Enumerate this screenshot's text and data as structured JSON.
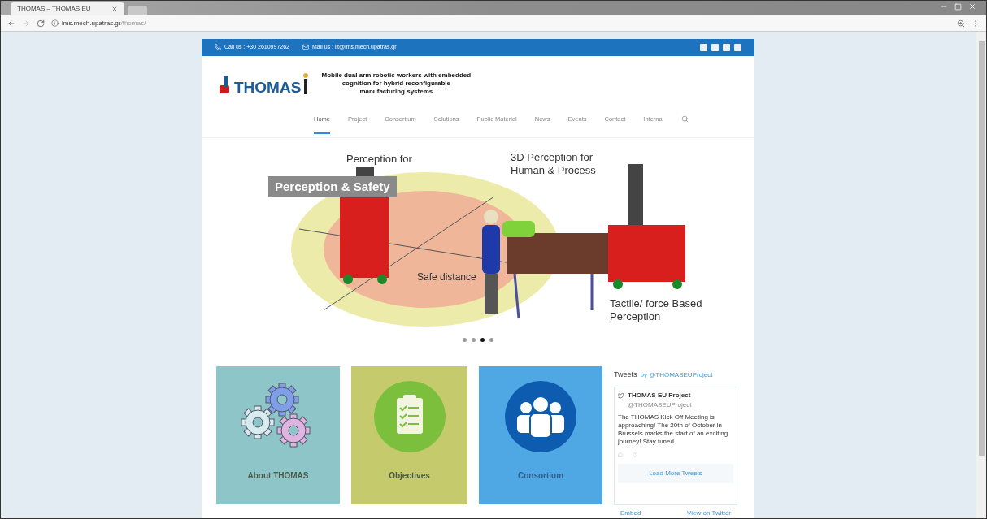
{
  "browser": {
    "tab": {
      "title": "THOMAS – THOMAS EU",
      "selected": true
    },
    "url": {
      "host": "lms.mech.upatras.gr",
      "path": "/thomas/"
    }
  },
  "top_bar": {
    "phone": "Call us : +30 2610997262",
    "mail": "Mail us : lit@lms.mech.upatras.gr"
  },
  "logo": {
    "text": "THOMAS",
    "tagline": "Mobile dual arm robotic workers with embedded cognition for hybrid reconfigurable manufacturing systems"
  },
  "nav": [
    {
      "label": "Home",
      "selected": true
    },
    {
      "label": "Project",
      "selected": false
    },
    {
      "label": "Consortium",
      "selected": false
    },
    {
      "label": "Solutions",
      "selected": false
    },
    {
      "label": "Public Material",
      "selected": false
    },
    {
      "label": "News",
      "selected": false
    },
    {
      "label": "Events",
      "selected": false
    },
    {
      "label": "Contact",
      "selected": false
    },
    {
      "label": "Internal",
      "selected": false
    }
  ],
  "slider": {
    "caption": "Perception & Safety",
    "labels": [
      "Perception for",
      "3D Perception for Human & Process",
      "Safe distance",
      "Tactile/ force Based Perception"
    ],
    "dots": [
      {
        "selected": false
      },
      {
        "selected": false
      },
      {
        "selected": true
      },
      {
        "selected": false
      }
    ]
  },
  "tiles": [
    {
      "kind": "gears",
      "label": "About THOMAS",
      "color": "#8ec5c9"
    },
    {
      "kind": "clipboard",
      "label": "Objectives",
      "color": "#c5cb6d"
    },
    {
      "kind": "people",
      "label": "Consortium",
      "color": "#4fa8e3"
    }
  ],
  "tweets": {
    "title": "Tweets",
    "by": "by @THOMASEUProject",
    "author": "THOMAS EU Project",
    "handle": "@THOMASEUProject",
    "text": "The THOMAS Kick Off Meeting is approaching! The 20th of October in Brussels marks the start of an exciting journey! Stay tuned.",
    "load_more": "Load More Tweets",
    "embed": "Embed",
    "view": "View on Twitter"
  }
}
